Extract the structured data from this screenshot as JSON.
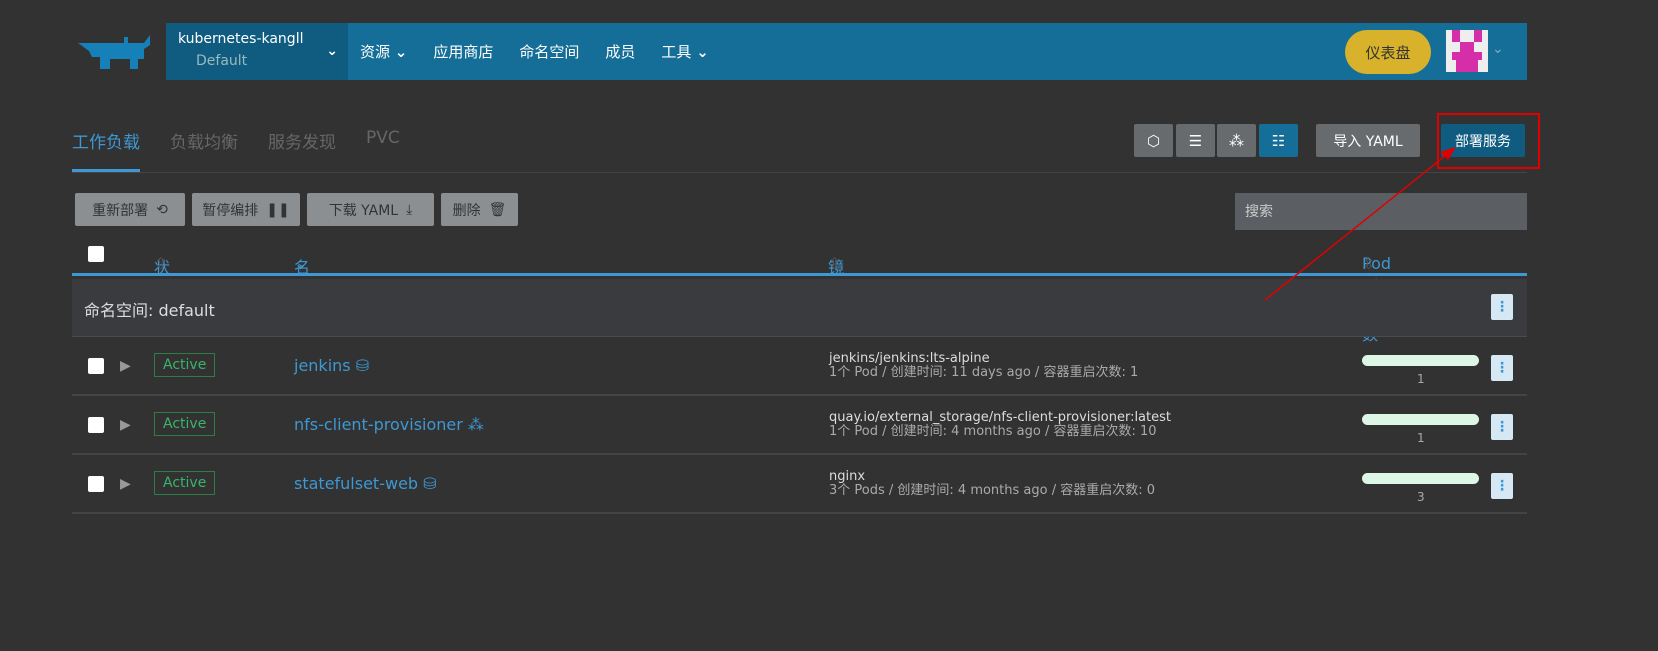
{
  "header": {
    "cluster_name": "kubernetes-kangll",
    "project": "Default",
    "nav": [
      "资源",
      "应用商店",
      "命名空间",
      "成员",
      "工具"
    ],
    "dashboard": "仪表盘"
  },
  "tabs": [
    "工作负载",
    "负载均衡",
    "服务发现",
    "PVC"
  ],
  "toolbar": {
    "import_yaml": "导入 YAML",
    "deploy": "部署服务"
  },
  "actions": {
    "redeploy": "重新部署",
    "pause": "暂停编排",
    "download": "下载 YAML",
    "delete": "删除"
  },
  "search": {
    "placeholder": "搜索"
  },
  "table": {
    "columns": [
      "状态",
      "名称",
      "镜像",
      "Pod 副本数"
    ],
    "group": "命名空间: default",
    "rows": [
      {
        "status": "Active",
        "name": "jenkins",
        "type_icon": "database-icon",
        "image": "jenkins/jenkins:lts-alpine",
        "detail": "1个 Pod / 创建时间: 11 days ago / 容器重启次数: 1",
        "pods": "1"
      },
      {
        "status": "Active",
        "name": "nfs-client-provisioner",
        "type_icon": "cubes-icon",
        "image": "quay.io/external_storage/nfs-client-provisioner:latest",
        "detail": "1个 Pod / 创建时间: 4 months ago / 容器重启次数: 10",
        "pods": "1"
      },
      {
        "status": "Active",
        "name": "statefulset-web",
        "type_icon": "database-icon",
        "image": "nginx",
        "detail": "3个 Pods / 创建时间: 4 months ago / 容器重启次数: 0",
        "pods": "3"
      }
    ]
  },
  "colors": {
    "header": "#146e98",
    "accent": "#3d98d3",
    "dashboard": "#d8b22a",
    "annotation": "#e00000"
  }
}
